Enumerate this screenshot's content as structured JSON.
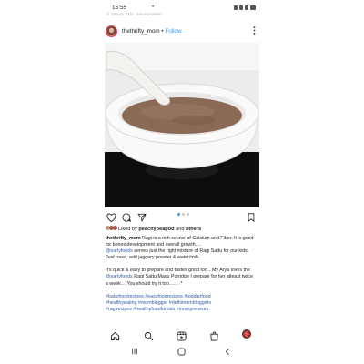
{
  "status_bar": {
    "time": "15:55",
    "dot": "•",
    "note": "© January 2020 · see translation"
  },
  "post": {
    "username": "thethrifty_mom",
    "separator": " • ",
    "follow_label": "Follow",
    "carousel": {
      "count": 3,
      "active_index": 0
    }
  },
  "likes": {
    "prefix": "Liked by ",
    "user": "peachypeapod",
    "middle": " and ",
    "others": "others"
  },
  "caption": {
    "user": "thethrifty_mom",
    "line1": " Ragi is a rich source of Calcium and Fiber. It is good for bones development and overall growth….",
    "mention1": "@earlyfoods",
    "line2": " serves just the right mixture of Ragi Sattu for our kids.",
    "line3": "Just roast, add jaggery powder & water/milk…",
    "para2_start": "It's quick & easy to prepare and tastes good too…My Arya loves the ",
    "mention2": "@earlyfoods",
    "para2_end": " Ragi Sattu Mavu Porridge I prepare for her atleast twice a week… You should try it too….. . *",
    "dot": ".",
    "hashtags1": "#babyfoodrecipes #easyfoodrecipes #toddlerfood",
    "hashtags2": "#healthyeating #momblogger #delhimombloggers",
    "hashtags3": "#ragirecipes #healthyfoodforkids #mompreneurs"
  },
  "colors": {
    "link": "#3897f0",
    "hashtag": "#2f5ea8",
    "porridge": "#8b6a55"
  },
  "icons": [
    "heart-icon",
    "comment-icon",
    "share-icon",
    "bookmark-icon",
    "home-icon",
    "search-icon",
    "reels-icon",
    "shop-icon",
    "profile-icon",
    "more-icon"
  ]
}
